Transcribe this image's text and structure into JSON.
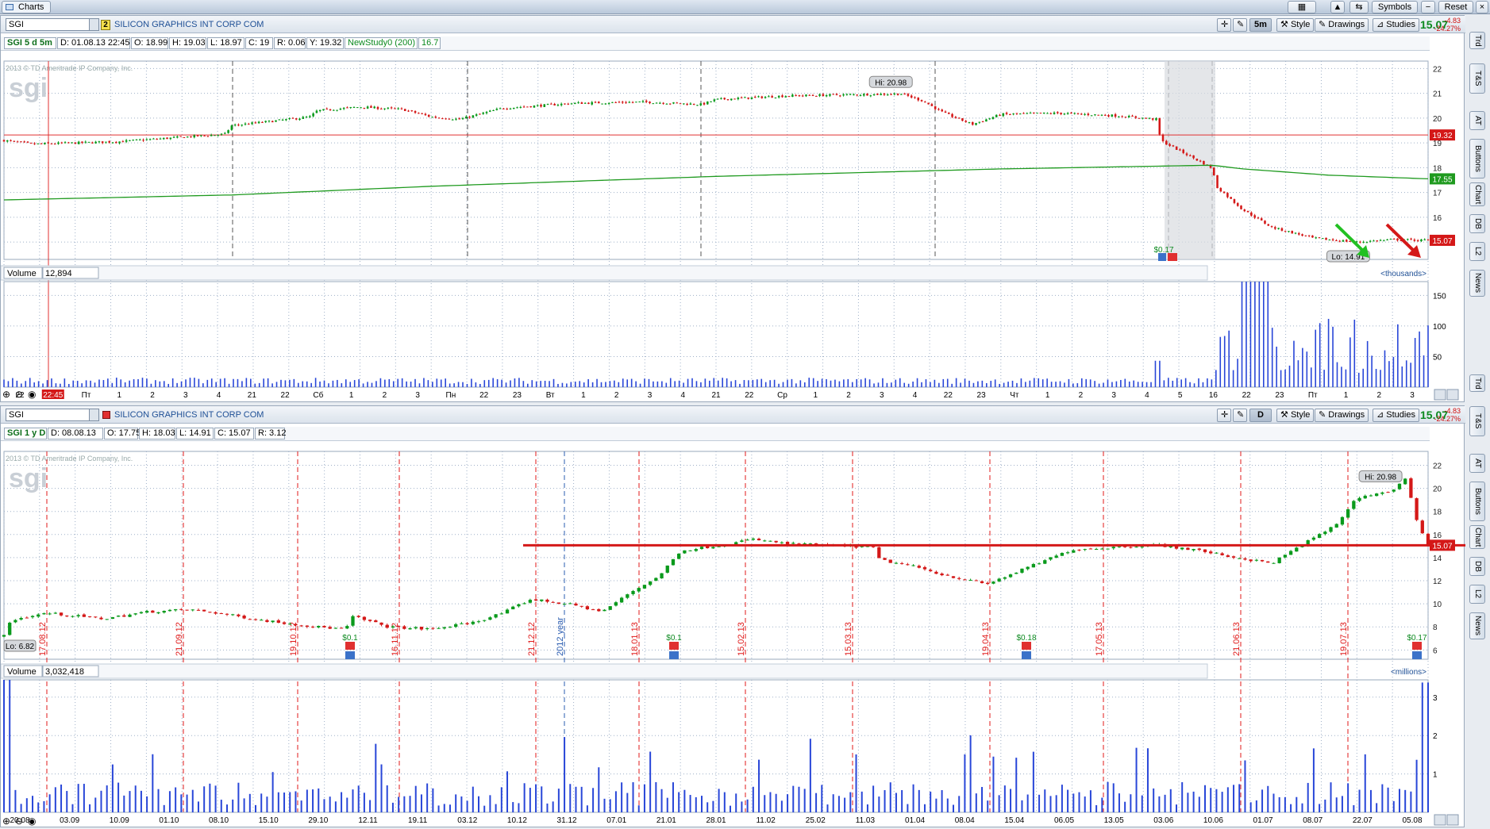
{
  "window": {
    "tab_label": "Charts"
  },
  "topbar": {
    "symbols_label": "Symbols",
    "reset_label": "Reset"
  },
  "colors": {
    "up": "#0a9a1c",
    "down": "#d41818",
    "grid": "#9fb0c8",
    "ma": "#1f9a1f",
    "volume": "#2846d8",
    "period": "#e01a1a",
    "support": "#d41818",
    "last_up": "#0c8a1f"
  },
  "side_tabs": [
    "Trd",
    "T&S",
    "AT",
    "Buttons",
    "Chart",
    "DB",
    "L2",
    "News"
  ],
  "chart1": {
    "symbol": "SGI",
    "company": "SILICON GRAPHICS INT CORP COM",
    "link_badge": "2",
    "aggregation": "5m",
    "style_label": "Style",
    "drawings_label": "Drawings",
    "studies_label": "Studies",
    "last": "15.07",
    "change": "-4.83",
    "change_pct": "-24.27%",
    "info": {
      "title": "SGI 5 d 5m",
      "d": "D: 01.08.13 22:45",
      "o": "O: 18.99",
      "h": "H: 19.03",
      "l": "L: 18.97",
      "c": "C: 19",
      "r": "R: 0.06",
      "y": "Y: 19.32",
      "study": "NewStudy0 (200)",
      "study_val": "16.7"
    },
    "watermark": "2013 © TD Ameritrade IP Company, Inc.",
    "logo": "sgi",
    "hi_label": "Hi: 20.98",
    "lo_label": "Lo: 14.91",
    "dividend": "$0.17",
    "price_markers": {
      "close": "19.32",
      "ma": "17.55",
      "last": "15.07"
    },
    "cursor_time": "22:45",
    "volume": {
      "label": "Volume",
      "value": "12,894",
      "unit": "<thousands>"
    },
    "chart_data": {
      "type": "candlestick",
      "y_ticks": [
        15,
        16,
        17,
        18,
        19,
        20,
        21,
        22
      ],
      "ylim": [
        14.3,
        22.3
      ],
      "hi": 20.98,
      "lo": 14.91,
      "prev_close": 19.32,
      "ma_last": 17.55,
      "last": 15.07,
      "price_path": [
        [
          0,
          19.1
        ],
        [
          0.02,
          18.95
        ],
        [
          0.08,
          19.05
        ],
        [
          0.155,
          19.35
        ],
        [
          0.16,
          19.7
        ],
        [
          0.2,
          19.95
        ],
        [
          0.215,
          20.05
        ],
        [
          0.22,
          20.3
        ],
        [
          0.25,
          20.45
        ],
        [
          0.28,
          20.35
        ],
        [
          0.3,
          20.05
        ],
        [
          0.32,
          19.95
        ],
        [
          0.35,
          20.4
        ],
        [
          0.4,
          20.6
        ],
        [
          0.45,
          20.65
        ],
        [
          0.49,
          20.55
        ],
        [
          0.5,
          20.75
        ],
        [
          0.55,
          20.9
        ],
        [
          0.6,
          20.95
        ],
        [
          0.63,
          20.98
        ],
        [
          0.645,
          20.7
        ],
        [
          0.66,
          20.2
        ],
        [
          0.68,
          19.75
        ],
        [
          0.7,
          20.15
        ],
        [
          0.74,
          20.2
        ],
        [
          0.78,
          20.1
        ],
        [
          0.81,
          19.95
        ],
        [
          0.812,
          19.1
        ],
        [
          0.848,
          18.0
        ],
        [
          0.852,
          17.2
        ],
        [
          0.87,
          16.3
        ],
        [
          0.89,
          15.6
        ],
        [
          0.92,
          15.15
        ],
        [
          0.95,
          15.0
        ],
        [
          0.975,
          15.1
        ],
        [
          1.0,
          15.07
        ]
      ],
      "ma_path": [
        [
          0,
          16.7
        ],
        [
          0.16,
          16.9
        ],
        [
          0.3,
          17.25
        ],
        [
          0.5,
          17.65
        ],
        [
          0.7,
          17.95
        ],
        [
          0.848,
          18.1
        ],
        [
          0.87,
          17.95
        ],
        [
          0.93,
          17.7
        ],
        [
          1.0,
          17.55
        ]
      ],
      "x_labels": [
        "22",
        "22:45",
        "Пт",
        "1",
        "2",
        "3",
        "4",
        "21",
        "22",
        "Сб",
        "1",
        "2",
        "3",
        "Пн",
        "22",
        "23",
        "Вт",
        "1",
        "2",
        "3",
        "4",
        "21",
        "22",
        "Ср",
        "1",
        "2",
        "3",
        "4",
        "22",
        "23",
        "Чт",
        "1",
        "2",
        "3",
        "4",
        "5",
        "16",
        "22",
        "23",
        "Пт",
        "1",
        "2",
        "3"
      ],
      "volume_ticks": [
        50,
        100,
        150
      ]
    }
  },
  "chart2": {
    "symbol": "SGI",
    "company": "SILICON GRAPHICS INT CORP COM",
    "aggregation": "D",
    "style_label": "Style",
    "drawings_label": "Drawings",
    "studies_label": "Studies",
    "last": "15.07",
    "change": "-4.83",
    "change_pct": "-24.27%",
    "info": {
      "title": "SGI 1 y D",
      "d": "D: 08.08.13",
      "o": "O: 17.75",
      "h": "H: 18.03",
      "l": "L: 14.91",
      "c": "C: 15.07",
      "r": "R: 3.12"
    },
    "watermark": "2013 © TD Ameritrade IP Company, Inc.",
    "logo": "sgi",
    "hi_label": "Hi: 20.98",
    "lo_label": "Lo: 6.82",
    "last_marker": "15.07",
    "period_labels": [
      "17.08.12",
      "21.09.12",
      "19.10.12",
      "16.11.12",
      "21.12.12",
      "2012 year",
      "18.01.13",
      "15.02.13",
      "15.03.13",
      "19.04.13",
      "17.05.13",
      "21.06.13",
      "19.07.13"
    ],
    "dividends": [
      "$0.1",
      "$0.1",
      "$0.18",
      "$0.17"
    ],
    "volume": {
      "label": "Volume",
      "value": "3,032,418",
      "unit": "<millions>"
    },
    "chart_data": {
      "type": "candlestick",
      "y_ticks": [
        6,
        8,
        10,
        12,
        14,
        16,
        18,
        20,
        22
      ],
      "ylim": [
        5.2,
        23.2
      ],
      "hi": 20.98,
      "lo": 6.82,
      "support": 15.07,
      "last": 15.07,
      "price_path": [
        [
          0,
          7.2
        ],
        [
          0.005,
          8.6
        ],
        [
          0.03,
          9.2
        ],
        [
          0.07,
          8.7
        ],
        [
          0.1,
          9.3
        ],
        [
          0.13,
          9.5
        ],
        [
          0.15,
          9.2
        ],
        [
          0.18,
          8.6
        ],
        [
          0.22,
          8.0
        ],
        [
          0.24,
          7.8
        ],
        [
          0.245,
          8.9
        ],
        [
          0.27,
          8.0
        ],
        [
          0.3,
          7.8
        ],
        [
          0.33,
          8.4
        ],
        [
          0.35,
          9.2
        ],
        [
          0.37,
          10.4
        ],
        [
          0.4,
          9.9
        ],
        [
          0.42,
          9.3
        ],
        [
          0.44,
          11.0
        ],
        [
          0.46,
          12.4
        ],
        [
          0.475,
          14.6
        ],
        [
          0.51,
          15.2
        ],
        [
          0.525,
          15.6
        ],
        [
          0.55,
          15.2
        ],
        [
          0.59,
          15.0
        ],
        [
          0.61,
          14.9
        ],
        [
          0.615,
          13.8
        ],
        [
          0.64,
          13.2
        ],
        [
          0.66,
          12.5
        ],
        [
          0.69,
          11.7
        ],
        [
          0.72,
          13.2
        ],
        [
          0.75,
          14.7
        ],
        [
          0.78,
          14.9
        ],
        [
          0.81,
          15.1
        ],
        [
          0.84,
          14.6
        ],
        [
          0.865,
          14.0
        ],
        [
          0.89,
          13.5
        ],
        [
          0.91,
          15.0
        ],
        [
          0.935,
          16.8
        ],
        [
          0.95,
          19.2
        ],
        [
          0.975,
          19.8
        ],
        [
          0.985,
          20.9
        ],
        [
          0.99,
          17.8
        ],
        [
          1.0,
          15.07
        ]
      ],
      "x_labels": [
        "20.08",
        "03.09",
        "10.09",
        "01.10",
        "08.10",
        "15.10",
        "29.10",
        "12.11",
        "19.11",
        "03.12",
        "10.12",
        "31.12",
        "07.01",
        "21.01",
        "28.01",
        "11.02",
        "25.02",
        "11.03",
        "01.04",
        "08.04",
        "15.04",
        "06.05",
        "13.05",
        "03.06",
        "10.06",
        "01.07",
        "08.07",
        "22.07",
        "05.08"
      ],
      "volume_ticks": [
        1,
        2,
        3
      ]
    }
  }
}
